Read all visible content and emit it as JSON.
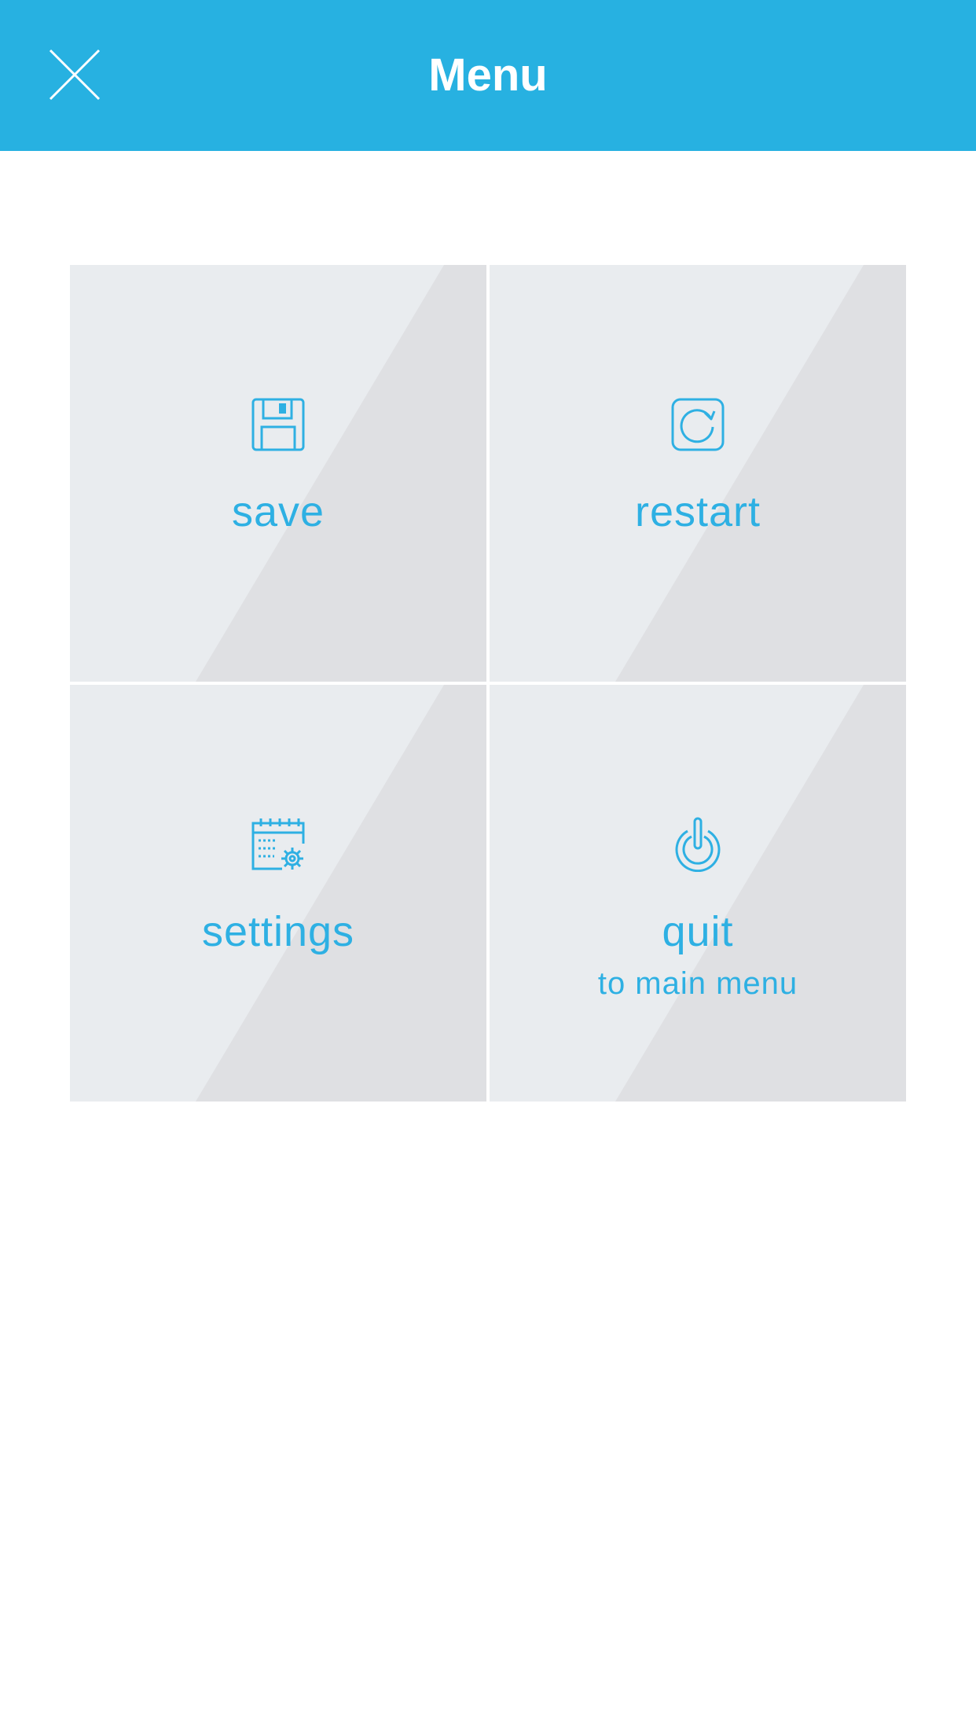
{
  "header": {
    "title": "Menu",
    "close_icon": "close-icon",
    "background_color": "#27b1e1"
  },
  "menu": {
    "accent_color": "#2eb0e3",
    "items": [
      {
        "label": "save",
        "icon": "floppy-disk-icon"
      },
      {
        "label": "restart",
        "icon": "restart-icon"
      },
      {
        "label": "settings",
        "icon": "calendar-gear-icon"
      },
      {
        "label": "quit",
        "sublabel": "to main menu",
        "icon": "power-icon"
      }
    ]
  }
}
